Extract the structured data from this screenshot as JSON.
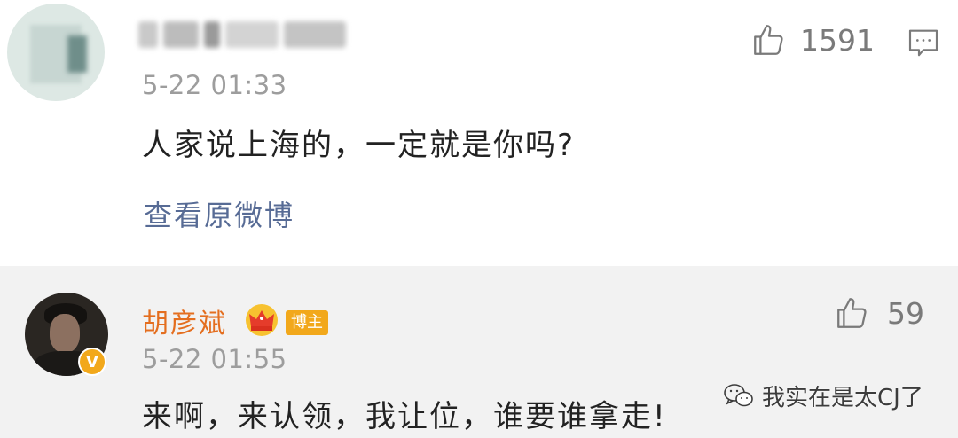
{
  "comment1": {
    "username": "",
    "timestamp": "5-22 01:33",
    "text": "人家说上海的，一定就是你吗?",
    "link": "查看原微博",
    "likes": "1591",
    "icons": [
      "thumb-up-icon",
      "comment-icon"
    ]
  },
  "comment2": {
    "username": "胡彦斌",
    "badge": "博主",
    "verified_mark": "V",
    "timestamp": "5-22 01:55",
    "text": "来啊，来认领，我让位，谁要谁拿走!",
    "likes": "59",
    "icons": [
      "crown-icon",
      "thumb-up-icon",
      "verified-icon"
    ]
  },
  "watermark": {
    "text": "我实在是太CJ了",
    "icon": "wechat-icon"
  },
  "colors": {
    "link": "#576b95",
    "timestamp": "#9d9d9d",
    "author_name": "#e46e1f",
    "badge": "#f2a81b",
    "reply_bg": "#f2f2f2"
  }
}
